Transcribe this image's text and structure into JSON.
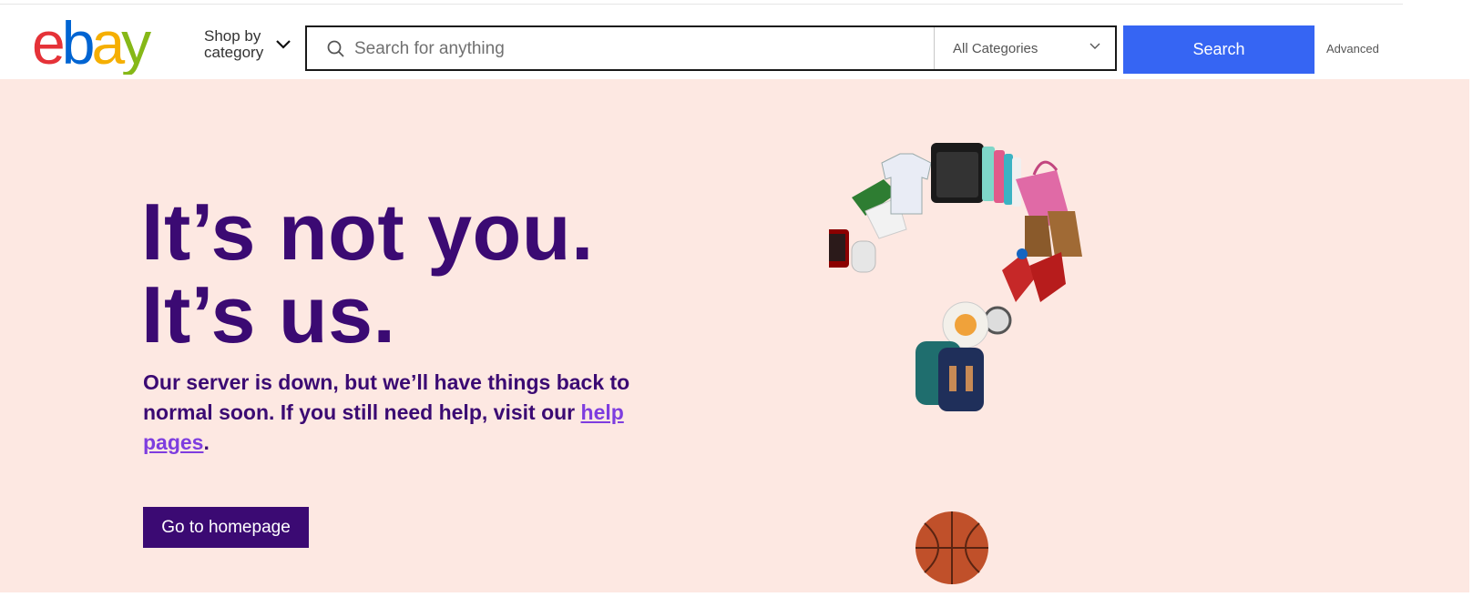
{
  "header": {
    "logo_letters": [
      "e",
      "b",
      "a",
      "y"
    ],
    "logo_colors": [
      "#e53238",
      "#0064d2",
      "#f5af02",
      "#86b817"
    ],
    "shop_by_category": [
      "Shop by",
      "category"
    ],
    "search": {
      "placeholder": "Search for anything",
      "value": "",
      "category_selected": "All Categories",
      "button_label": "Search",
      "accent_color": "#3665f3"
    },
    "advanced_label": "Advanced"
  },
  "main": {
    "background_color": "#fde8e2",
    "headline": [
      "It’s not you.",
      "It’s us."
    ],
    "message_text": "Our server is down, but we’ll have things back to normal soon. If you still need help, visit our ",
    "help_link_label": "help pages",
    "message_end": ".",
    "home_button_label": "Go to homepage",
    "text_color": "#3b0a73",
    "link_color": "#7e3ddf",
    "illustration_items": [
      "sneakers",
      "soccer-jersey",
      "bluetooth-speaker",
      "phone-cases",
      "handbag",
      "ankle-boots",
      "coffee-press",
      "smart-speaker",
      "superhero-figurines",
      "droid-toy",
      "wristwatch",
      "backpacks",
      "signed-basketball"
    ]
  }
}
